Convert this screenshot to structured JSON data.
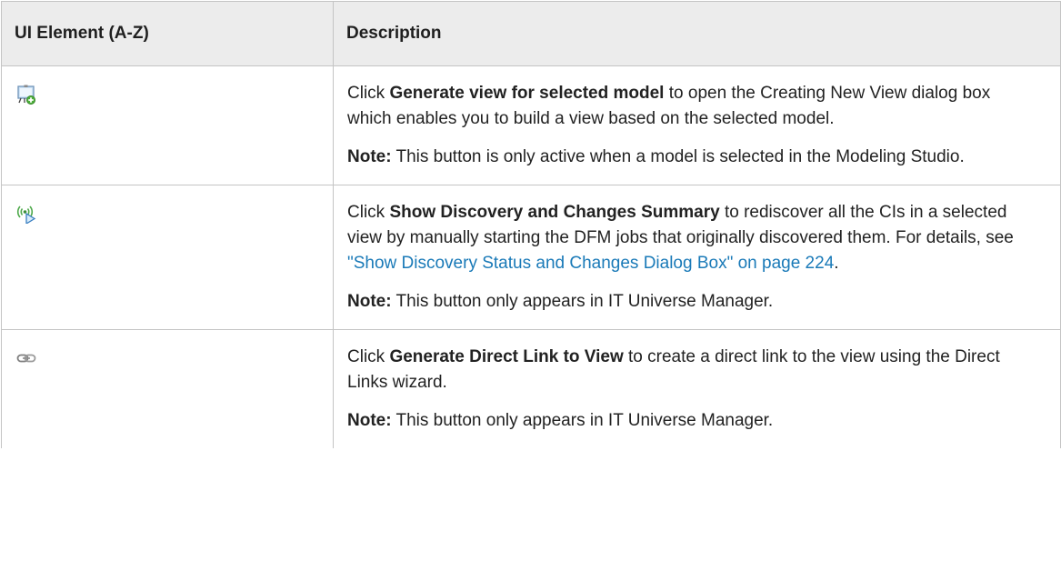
{
  "table": {
    "headers": [
      "UI Element (A-Z)",
      "Description"
    ],
    "rows": [
      {
        "icon": "generate-view-icon",
        "desc_pre": "Click ",
        "desc_bold": "Generate view for selected model",
        "desc_post": " to open the Creating New View dialog box which enables you to build a view based on the selected model.",
        "note_label": "Note:",
        "note_text": " This button is only active when a model is selected in the Modeling Studio."
      },
      {
        "icon": "discovery-summary-icon",
        "desc_pre": "Click ",
        "desc_bold": "Show Discovery and Changes Summary",
        "desc_post": " to rediscover all the CIs in a selected view by manually starting the DFM jobs that originally discovered them. For details, see ",
        "link_text": "\"Show Discovery Status and Changes Dialog Box\" on page 224",
        "desc_end": ".",
        "note_label": "Note:",
        "note_text": " This button only appears in IT Universe Manager."
      },
      {
        "icon": "direct-link-icon",
        "desc_pre": "Click ",
        "desc_bold": "Generate Direct Link to View",
        "desc_post": " to create a direct link to the view using the Direct Links wizard.",
        "note_label": "Note:",
        "note_text": " This button only appears in IT Universe Manager."
      }
    ]
  }
}
